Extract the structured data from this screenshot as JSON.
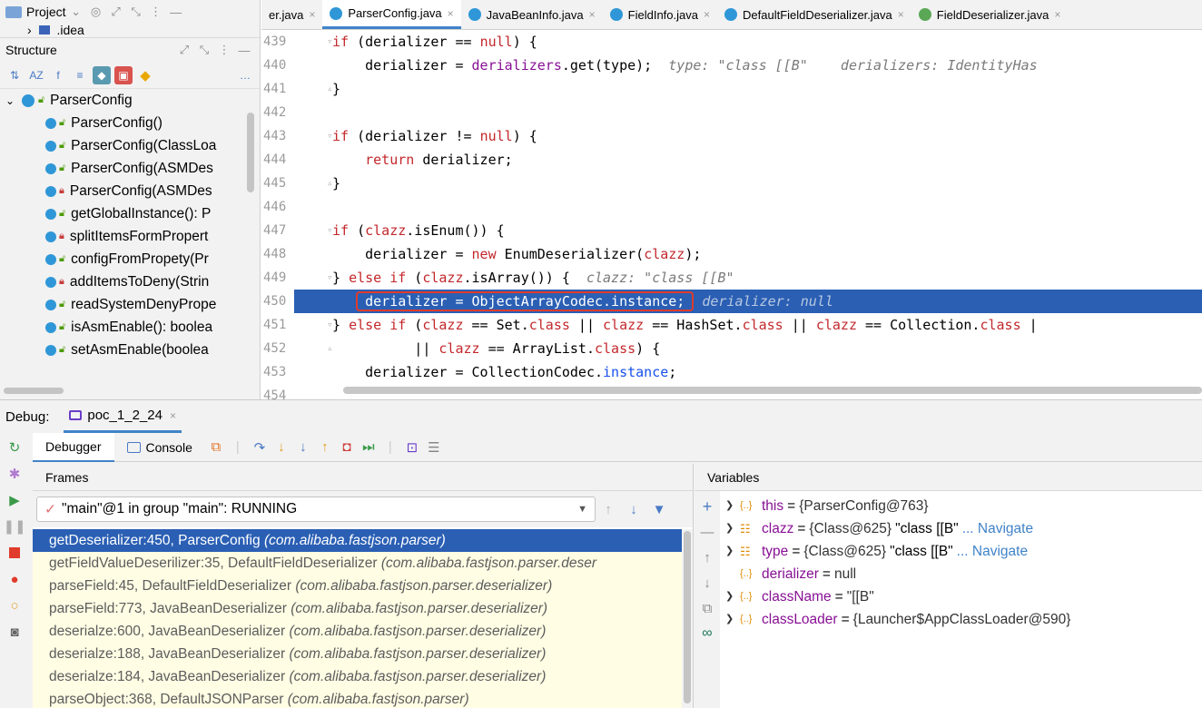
{
  "project_panel": {
    "title": "Project",
    "idea_folder": ".idea"
  },
  "structure_panel": {
    "title": "Structure",
    "root": "ParserConfig",
    "items": [
      {
        "label": "ParserConfig()",
        "access": "public"
      },
      {
        "label": "ParserConfig(ClassLoa",
        "access": "public"
      },
      {
        "label": "ParserConfig(ASMDes",
        "access": "public"
      },
      {
        "label": "ParserConfig(ASMDes",
        "access": "private"
      },
      {
        "label": "getGlobalInstance(): P",
        "access": "public"
      },
      {
        "label": "splitItemsFormPropert",
        "access": "private"
      },
      {
        "label": "configFromPropety(Pr",
        "access": "public"
      },
      {
        "label": "addItemsToDeny(Strin",
        "access": "private"
      },
      {
        "label": "readSystemDenyPrope",
        "access": "public"
      },
      {
        "label": "isAsmEnable(): boolea",
        "access": "public"
      },
      {
        "label": "setAsmEnable(boolea",
        "access": "public"
      }
    ]
  },
  "editor": {
    "tabs": [
      {
        "label": "er.java",
        "active": false,
        "icon": "class"
      },
      {
        "label": "ParserConfig.java",
        "active": true,
        "icon": "class"
      },
      {
        "label": "JavaBeanInfo.java",
        "active": false,
        "icon": "class"
      },
      {
        "label": "FieldInfo.java",
        "active": false,
        "icon": "class"
      },
      {
        "label": "DefaultFieldDeserializer.java",
        "active": false,
        "icon": "class"
      },
      {
        "label": "FieldDeserializer.java",
        "active": false,
        "icon": "interface"
      }
    ],
    "line_numbers": [
      "439",
      "440",
      "441",
      "442",
      "443",
      "444",
      "445",
      "446",
      "447",
      "448",
      "449",
      "450",
      "451",
      "452",
      "453",
      "454"
    ],
    "hints": {
      "l440": "type: \"class [[B\"    derializers: IdentityHas",
      "l449": "clazz: \"class [[B\"",
      "l450": "derializer: null"
    }
  },
  "debug": {
    "label": "Debug:",
    "config_name": "poc_1_2_24",
    "tabs": {
      "debugger": "Debugger",
      "console": "Console"
    },
    "frames_header": "Frames",
    "variables_header": "Variables",
    "thread": "\"main\"@1 in group \"main\": RUNNING",
    "frames": [
      {
        "method": "getDeserializer:450, ParserConfig",
        "pkg": "(com.alibaba.fastjson.parser)",
        "selected": true
      },
      {
        "method": "getFieldValueDeserilizer:35, DefaultFieldDeserializer",
        "pkg": "(com.alibaba.fastjson.parser.deser",
        "selected": false
      },
      {
        "method": "parseField:45, DefaultFieldDeserializer",
        "pkg": "(com.alibaba.fastjson.parser.deserializer)",
        "selected": false
      },
      {
        "method": "parseField:773, JavaBeanDeserializer",
        "pkg": "(com.alibaba.fastjson.parser.deserializer)",
        "selected": false
      },
      {
        "method": "deserialze:600, JavaBeanDeserializer",
        "pkg": "(com.alibaba.fastjson.parser.deserializer)",
        "selected": false
      },
      {
        "method": "deserialze:188, JavaBeanDeserializer",
        "pkg": "(com.alibaba.fastjson.parser.deserializer)",
        "selected": false
      },
      {
        "method": "deserialze:184, JavaBeanDeserializer",
        "pkg": "(com.alibaba.fastjson.parser.deserializer)",
        "selected": false
      },
      {
        "method": "parseObject:368, DefaultJSONParser",
        "pkg": "(com.alibaba.fastjson.parser)",
        "selected": false
      }
    ],
    "variables": [
      {
        "expand": true,
        "icon": "object",
        "name": "this",
        "value": "{ParserConfig@763}",
        "str": "",
        "nav": ""
      },
      {
        "expand": true,
        "icon": "field",
        "name": "clazz",
        "value": "{Class@625}",
        "str": "\"class [[B\"",
        "nav": "... Navigate"
      },
      {
        "expand": true,
        "icon": "field",
        "name": "type",
        "value": "{Class@625}",
        "str": "\"class [[B\"",
        "nav": "... Navigate"
      },
      {
        "expand": false,
        "icon": "object",
        "name": "derializer",
        "value": "null",
        "str": "",
        "nav": ""
      },
      {
        "expand": true,
        "icon": "object",
        "name": "className",
        "value": "\"[[B\"",
        "str": "",
        "nav": ""
      },
      {
        "expand": true,
        "icon": "object",
        "name": "classLoader",
        "value": "{Launcher$AppClassLoader@590}",
        "str": "",
        "nav": ""
      }
    ]
  }
}
